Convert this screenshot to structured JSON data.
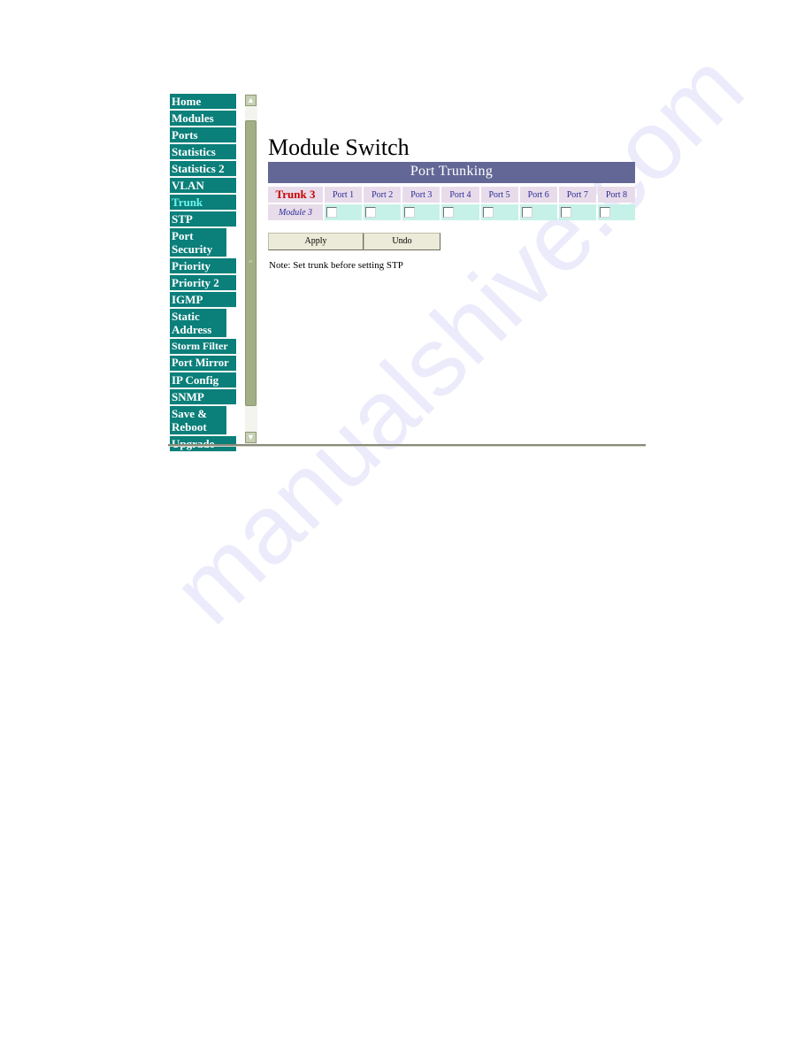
{
  "watermark": "manualshive.com",
  "sidebar": {
    "items": [
      {
        "label": "Home"
      },
      {
        "label": "Modules"
      },
      {
        "label": "Ports"
      },
      {
        "label": "Statistics"
      },
      {
        "label": "Statistics 2"
      },
      {
        "label": "VLAN"
      },
      {
        "label": "Trunk",
        "active": true
      },
      {
        "label": "STP"
      },
      {
        "label": "Port Security"
      },
      {
        "label": "Priority"
      },
      {
        "label": "Priority 2"
      },
      {
        "label": "IGMP"
      },
      {
        "label": "Static Address"
      },
      {
        "label": "Storm Filter"
      },
      {
        "label": "Port Mirror"
      },
      {
        "label": "IP Config"
      },
      {
        "label": "SNMP"
      },
      {
        "label": "Save & Reboot"
      },
      {
        "label": "Upgrade"
      }
    ]
  },
  "page": {
    "title": "Module Switch",
    "panel_title": "Port Trunking",
    "trunk_label": "Trunk 3",
    "module_label": "Module 3",
    "ports": [
      "Port 1",
      "Port 2",
      "Port 3",
      "Port 4",
      "Port 5",
      "Port 6",
      "Port 7",
      "Port 8"
    ],
    "port_checked": [
      false,
      false,
      false,
      false,
      false,
      false,
      false,
      false
    ],
    "apply_label": "Apply",
    "undo_label": "Undo",
    "note": "Note: Set trunk before setting STP"
  },
  "colors": {
    "nav_bg": "#0b7f7a",
    "nav_active_text": "#6ff5ec",
    "panel_header_bg": "#636796",
    "trunk_label": "#cc0000",
    "port_header_bg": "#e8dcea",
    "checkbox_row_bg": "#c6f1e8"
  }
}
